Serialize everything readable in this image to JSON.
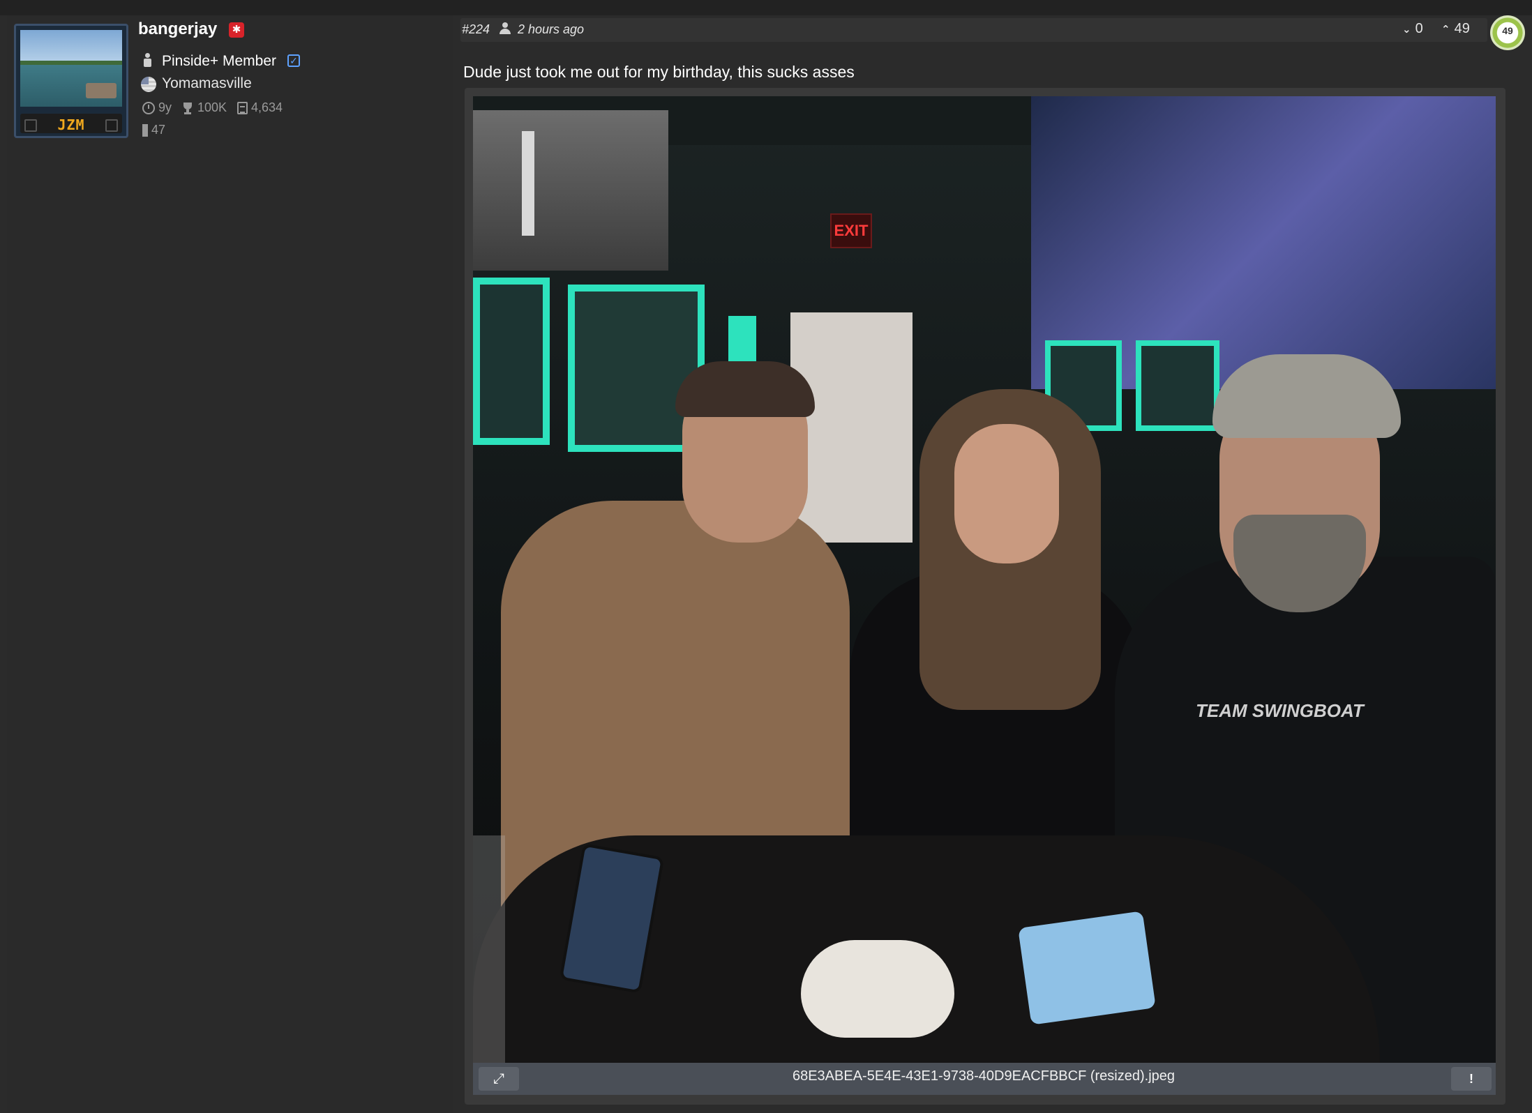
{
  "user": {
    "username": "bangerjay",
    "avatar_plate": "JZM",
    "membership": "Pinside+ Member",
    "location": "Yomamasville",
    "stats": {
      "years": "9y",
      "points": "100K",
      "posts": "4,634",
      "bookmarks": "47"
    }
  },
  "post": {
    "number": "#224",
    "time": "2 hours ago",
    "downvotes": "0",
    "upvotes": "49",
    "score_badge": "49",
    "text": "Dude just took me out for my birthday, this sucks asses"
  },
  "attachment": {
    "filename": "68E3ABEA-5E4E-43E1-9738-40D9EACFBBCF (resized).jpeg",
    "photo_text": {
      "exit_sign": "EXIT",
      "shirt": "TEAM SWINGBOAT"
    }
  },
  "icons": {
    "moderator": "moderator-badge-icon",
    "member": "member-person-icon",
    "verified": "checkbox-verified-icon",
    "flag": "us-flag-icon",
    "clock": "clock-icon",
    "trophy": "trophy-icon",
    "posts": "document-icon",
    "bookmark": "bookmark-icon",
    "user": "user-icon",
    "expand": "expand-icon",
    "report": "report-icon"
  },
  "colors": {
    "background": "#2b2b2b",
    "moderator_badge": "#d8232a",
    "verified": "#5ea2ff",
    "plate_text": "#f0a81e",
    "score_ring": "#9cc34b"
  }
}
